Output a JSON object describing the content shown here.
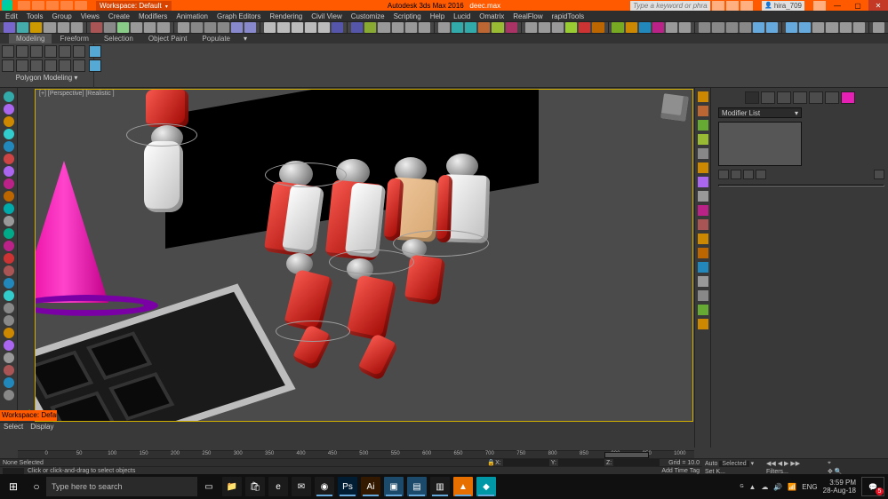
{
  "titlebar": {
    "workspace_prefix": "Workspace:",
    "workspace_name": "Default",
    "app_name": "Autodesk 3ds Max 2016",
    "file_name": "deec.max",
    "search_placeholder": "Type a keyword or phrase",
    "signin_label": "hira_709",
    "min": "—",
    "max": "▢",
    "close": "✕"
  },
  "menubar": [
    "Edit",
    "Tools",
    "Group",
    "Views",
    "Create",
    "Modifiers",
    "Animation",
    "Graph Editors",
    "Rendering",
    "Civil View",
    "Customize",
    "Scripting",
    "Help",
    "Lucid",
    "Omatrix",
    "RealFlow",
    "rapidTools"
  ],
  "ribbon": {
    "tabs": [
      "Modeling",
      "Freeform",
      "Selection",
      "Object Paint",
      "Populate"
    ],
    "active": 0,
    "panel_label": "Polygon Modeling",
    "expand_glyph": "▾"
  },
  "viewport": {
    "label": "[+] [Perspective] [Realistic ]"
  },
  "select_display": {
    "select": "Select",
    "display": "Display"
  },
  "workspace_badge": "Workspace: Defau",
  "rightpanel": {
    "dropdown": "Modifier List",
    "dd_glyph": "▾"
  },
  "timeline": {
    "ticks": [
      "0",
      "50",
      "100",
      "150",
      "200",
      "250",
      "300",
      "350",
      "400",
      "450",
      "500",
      "550",
      "600",
      "650",
      "700",
      "750",
      "800",
      "850",
      "900",
      "950",
      "1000"
    ],
    "larrow": "◀",
    "rarrow": "▶"
  },
  "status": {
    "selection": "None Selected",
    "hint": "Click or click-and-drag to select objects",
    "x": "X:",
    "y": "Y:",
    "z": "Z:",
    "grid": "Grid = 10.0",
    "auto": "Auto",
    "selected": "Selected",
    "setkey": "Set K...",
    "keyfilters": "Filters...",
    "addtimetag": "Add Time Tag"
  },
  "taskbar": {
    "cortana": "Type here to search",
    "time": "3:59 PM",
    "date": "28-Aug-18",
    "notif_count": "5",
    "apps": [
      {
        "name": "task-view",
        "glyph": "▭",
        "bg": "#101010"
      },
      {
        "name": "explorer",
        "glyph": "📁",
        "bg": "#1b1b1b"
      },
      {
        "name": "store",
        "glyph": "🛍",
        "bg": "#1b1b1b"
      },
      {
        "name": "edge",
        "glyph": "e",
        "bg": "#1b1b1b"
      },
      {
        "name": "mail",
        "glyph": "✉",
        "bg": "#1b1b1b"
      },
      {
        "name": "chrome",
        "glyph": "◉",
        "bg": "#1b1b1b",
        "active": true
      },
      {
        "name": "photoshop",
        "glyph": "Ps",
        "bg": "#001d33",
        "active": true
      },
      {
        "name": "illust",
        "glyph": "Ai",
        "bg": "#331900",
        "active": true
      },
      {
        "name": "app1",
        "glyph": "▣",
        "bg": "#1b4a6a",
        "active": true
      },
      {
        "name": "app2",
        "glyph": "▤",
        "bg": "#1b4a6a",
        "active": true
      },
      {
        "name": "app3",
        "glyph": "▥",
        "bg": "#1b1b1b",
        "active": true
      },
      {
        "name": "vlc",
        "glyph": "▲",
        "bg": "#e76f00",
        "active": true
      },
      {
        "name": "3dsmax",
        "glyph": "◆",
        "bg": "#0098a6",
        "active": true
      }
    ],
    "tray_glyphs": [
      "ᴳ",
      "▲",
      "☁",
      "🔊",
      "📶",
      "ENG"
    ]
  },
  "toolbar_colors": [
    "#76c",
    "#4aa",
    "#c90",
    "#999",
    "#999",
    "#999",
    "#a55",
    "#888",
    "#8c8",
    "#999",
    "#999",
    "#999",
    "#999",
    "#888",
    "#888",
    "#888",
    "#88c",
    "#88c",
    "#bbb",
    "#bbb",
    "#bbb",
    "#bbb",
    "#bbb",
    "#55a",
    "#55a",
    "#8a3",
    "#999",
    "#999",
    "#999",
    "#999",
    "#999",
    "#3aa",
    "#3aa",
    "#b63",
    "#9b3",
    "#a36",
    "#999",
    "#999",
    "#999",
    "#9c3",
    "#c33",
    "#b60",
    "#7a2",
    "#c80",
    "#28b",
    "#b28",
    "#999",
    "#999",
    "#888",
    "#888",
    "#888",
    "#888",
    "#6ad",
    "#6ad",
    "#6ad",
    "#6ad",
    "#999",
    "#999",
    "#999",
    "#999",
    "#999"
  ],
  "left_strip_colors": [
    "#3aa",
    "#a6e",
    "#c80",
    "#3cc",
    "#28b",
    "#c44",
    "#a6e",
    "#b28",
    "#b60",
    "#0aa",
    "#999",
    "#0a8",
    "#b28",
    "#c33",
    "#a55",
    "#28b",
    "#3cc",
    "#888",
    "#888",
    "#c80",
    "#a6e",
    "#999",
    "#a55",
    "#28b",
    "#888"
  ],
  "right_strip_colors": [
    "#c80",
    "#b63",
    "#6a3",
    "#9b3",
    "#888",
    "#c80",
    "#a6e",
    "#999",
    "#b28",
    "#a55",
    "#c80",
    "#b60",
    "#28b",
    "#999",
    "#888",
    "#6a3",
    "#c80"
  ]
}
